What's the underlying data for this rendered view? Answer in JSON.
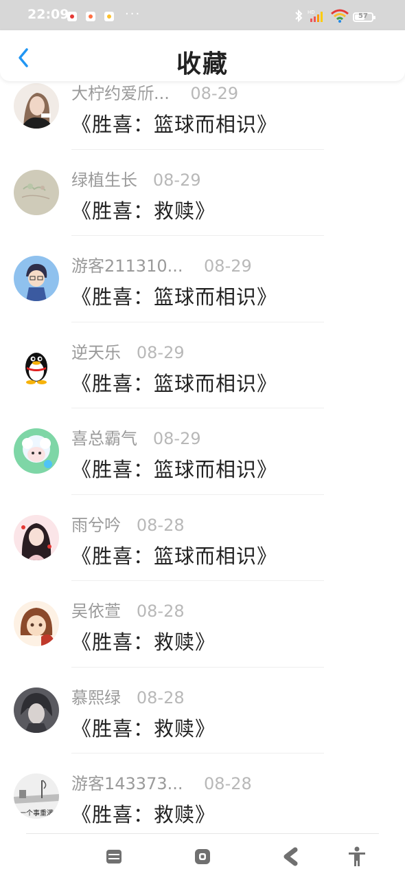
{
  "status_bar": {
    "time": "22:09",
    "more": "···",
    "battery_level": "57",
    "battery_fraction": 0.57
  },
  "header": {
    "title": "收藏"
  },
  "favorites": [
    {
      "user": "大柠约爱斦...",
      "date": "08-29",
      "work": "《胜喜：篮球而相识》"
    },
    {
      "user": "绿植生长",
      "date": "08-29",
      "work": "《胜喜：救赎》"
    },
    {
      "user": "游客211310...",
      "date": "08-29",
      "work": "《胜喜：篮球而相识》"
    },
    {
      "user": "逆天乐",
      "date": "08-29",
      "work": "《胜喜：篮球而相识》"
    },
    {
      "user": "喜总霸气",
      "date": "08-29",
      "work": "《胜喜：篮球而相识》"
    },
    {
      "user": "雨兮吟",
      "date": "08-28",
      "work": "《胜喜：篮球而相识》"
    },
    {
      "user": "吴依萱",
      "date": "08-28",
      "work": "《胜喜：救赎》"
    },
    {
      "user": "慕熙绿",
      "date": "08-28",
      "work": "《胜喜：救赎》"
    },
    {
      "user": "游客143373...",
      "date": "08-28",
      "work": "《胜喜：救赎》"
    }
  ],
  "avatars": [
    {
      "icon": "portrait-avatar",
      "colors": [
        "#8a6a55",
        "#e9d9cf"
      ]
    },
    {
      "icon": "plant-sketch-avatar",
      "colors": [
        "#cfcbb9",
        "#a9b89a"
      ]
    },
    {
      "icon": "anime-boy-avatar",
      "colors": [
        "#7fb2e6",
        "#3a3f6a"
      ]
    },
    {
      "icon": "qq-penguin-avatar",
      "colors": [
        "#ffffff",
        "#000000"
      ]
    },
    {
      "icon": "cartoon-sheep-avatar",
      "colors": [
        "#7ed6a6",
        "#d9f0ff"
      ]
    },
    {
      "icon": "anime-girl-avatar",
      "colors": [
        "#f2c9cf",
        "#2a1d22"
      ]
    },
    {
      "icon": "cartoon-girl-avatar",
      "colors": [
        "#f4cfa8",
        "#c0392b"
      ]
    },
    {
      "icon": "dark-anime-avatar",
      "colors": [
        "#4a4a4f",
        "#c9c3c3"
      ]
    },
    {
      "icon": "photo-avatar",
      "colors": [
        "#e7e7e7",
        "#777777"
      ]
    }
  ],
  "last_avatar_caption": "一个事重满",
  "colors": {
    "accent": "#2196f3",
    "status_bar": "#d7d7d7",
    "primary_text": "#222222",
    "secondary_text": "#9a9a9a"
  },
  "nav_bar": {
    "buttons": [
      "menu-icon",
      "home-icon",
      "back-icon",
      "accessibility-icon"
    ]
  }
}
